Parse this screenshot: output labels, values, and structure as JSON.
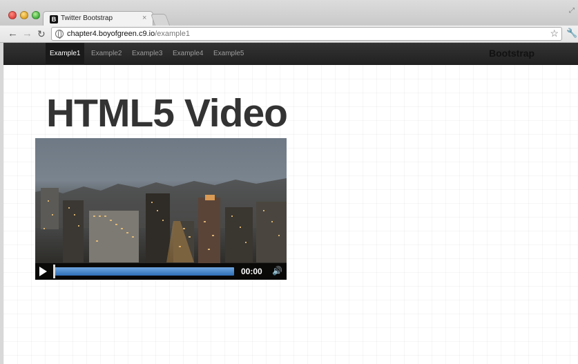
{
  "browser": {
    "tab_title": "Twitter Bootstrap",
    "tab_favicon": "B",
    "tab_close": "×",
    "url_host": "chapter4.boyofgreen.c9.io",
    "url_path": "/example1"
  },
  "navbar": {
    "items": [
      {
        "label": "Example1",
        "active": true
      },
      {
        "label": "Example2",
        "active": false
      },
      {
        "label": "Example3",
        "active": false
      },
      {
        "label": "Example4",
        "active": false
      },
      {
        "label": "Example5",
        "active": false
      }
    ],
    "brand": "Bootstrap"
  },
  "main": {
    "heading": "HTML5 Video"
  },
  "video": {
    "time": "00:00",
    "progress": 0.0
  },
  "icons": {
    "back": "back-arrow-icon",
    "forward": "forward-arrow-icon",
    "reload": "reload-icon",
    "star": "star-icon",
    "wrench": "wrench-icon",
    "play": "play-icon",
    "volume": "volume-icon"
  }
}
